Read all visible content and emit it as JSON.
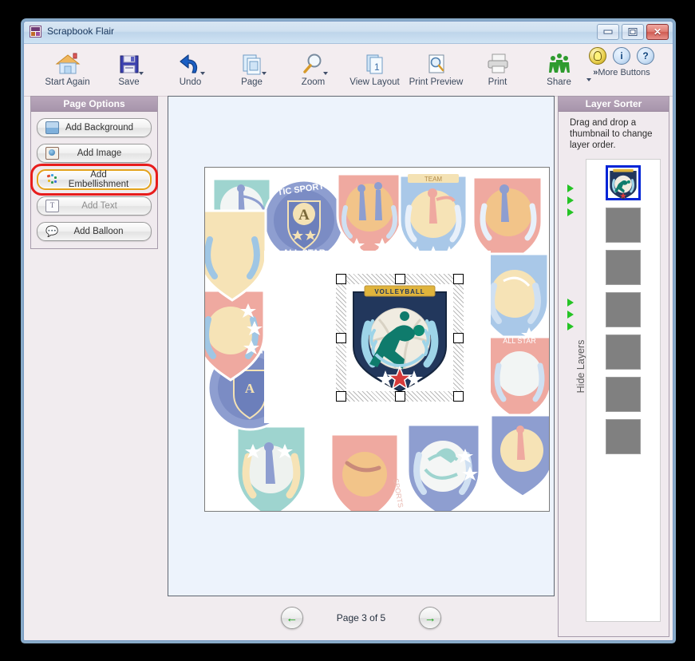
{
  "window": {
    "title": "Scrapbook Flair",
    "icon": "app-icon",
    "controls": {
      "minimize": "–",
      "maximize": "□",
      "close": "✕"
    }
  },
  "toolbar": {
    "items": [
      {
        "label": "Start Again",
        "icon": "home-icon",
        "dropdown": false
      },
      {
        "label": "Save",
        "icon": "floppy-disk-icon",
        "dropdown": true
      },
      {
        "label": "Undo",
        "icon": "undo-arrow-icon",
        "dropdown": true
      },
      {
        "label": "Page",
        "icon": "pages-icon",
        "dropdown": true
      },
      {
        "label": "Zoom",
        "icon": "magnifier-icon",
        "dropdown": true
      },
      {
        "label": "View Layout",
        "icon": "layout-icon",
        "dropdown": false
      },
      {
        "label": "Print Preview",
        "icon": "print-preview-icon",
        "dropdown": false
      },
      {
        "label": "Print",
        "icon": "printer-icon",
        "dropdown": false
      },
      {
        "label": "Share",
        "icon": "share-people-icon",
        "dropdown": false
      }
    ],
    "helpers": [
      {
        "icon": "lightbulb-tip-icon",
        "glyph": ""
      },
      {
        "icon": "info-icon",
        "glyph": "i"
      },
      {
        "icon": "help-question-icon",
        "glyph": "?"
      }
    ],
    "more_buttons": "More Buttons",
    "more_chevron": "»"
  },
  "sidebar": {
    "title": "Page Options",
    "items": [
      {
        "label": "Add Background",
        "icon": "background-icon",
        "state": "normal"
      },
      {
        "label": "Add Image",
        "icon": "image-icon",
        "state": "normal"
      },
      {
        "label": "Add Embellishment",
        "icon": "embellishment-icon",
        "state": "highlighted"
      },
      {
        "label": "Add Text",
        "icon": "text-icon",
        "state": "disabled"
      },
      {
        "label": "Add Balloon",
        "icon": "balloon-icon",
        "state": "normal"
      }
    ]
  },
  "layer_sorter": {
    "title": "Layer Sorter",
    "hint": "Drag and drop a thumbnail to change layer order.",
    "hide_layers_label": "Hide Layers",
    "thumbnails": [
      {
        "name": "volleyball-emblem-thumbnail",
        "selected": true
      },
      {
        "name": "layer-thumbnail",
        "selected": false
      },
      {
        "name": "layer-thumbnail",
        "selected": false
      },
      {
        "name": "layer-thumbnail",
        "selected": false
      },
      {
        "name": "layer-thumbnail",
        "selected": false
      },
      {
        "name": "layer-thumbnail",
        "selected": false
      },
      {
        "name": "layer-thumbnail",
        "selected": false
      }
    ]
  },
  "pager": {
    "prev_icon": "left-arrow-icon",
    "next_icon": "right-arrow-icon",
    "label": "Page 3 of 5"
  },
  "canvas": {
    "selected_object": "volleyball-emblem",
    "emblem_banner_text": "VOLLEYBALL",
    "background_name": "sports-badges-collage-border"
  },
  "colors": {
    "titlebar_blue": "#cfe0f0",
    "panel_header_purple": "#a794ab",
    "highlight_red": "#e81c1c",
    "focus_gold": "#e3a21c",
    "canvas_blue": "#edf3fc",
    "emblem_navy": "#1f3a5f",
    "emblem_gold": "#e3b04b",
    "emblem_teal": "#0f7b6c",
    "arrow_green": "#25c425"
  }
}
